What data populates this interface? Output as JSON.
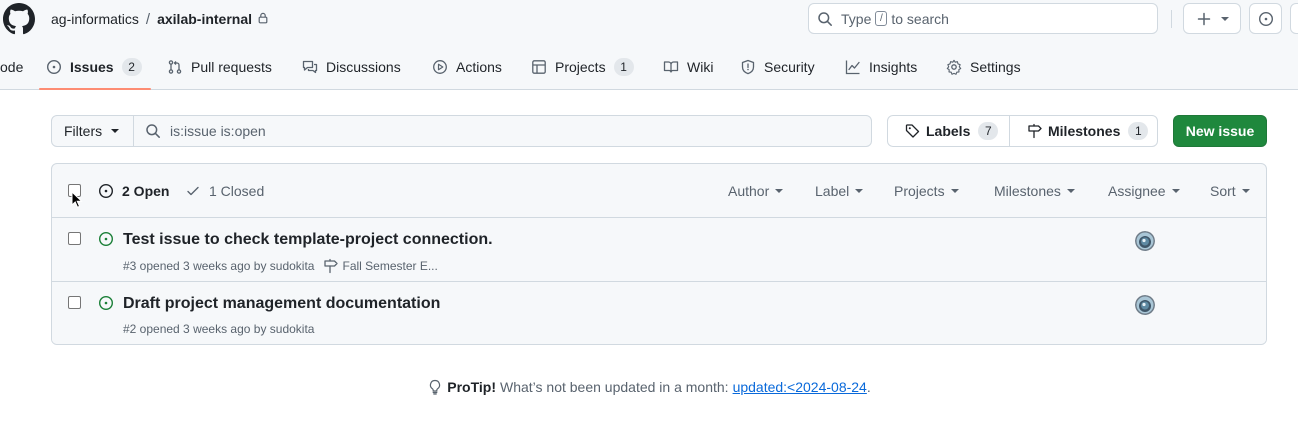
{
  "header": {
    "org": "ag-informatics",
    "separator": "/",
    "repo": "axilab-internal",
    "search_prefix": "Type",
    "search_key": "/",
    "search_suffix": "to search"
  },
  "nav": {
    "code_label": "ode",
    "issues_label": "Issues",
    "issues_count": "2",
    "pulls_label": "Pull requests",
    "discussions_label": "Discussions",
    "actions_label": "Actions",
    "projects_label": "Projects",
    "projects_count": "1",
    "wiki_label": "Wiki",
    "security_label": "Security",
    "insights_label": "Insights",
    "settings_label": "Settings"
  },
  "toolbar": {
    "filters_label": "Filters",
    "filter_query": "is:issue is:open",
    "labels_label": "Labels",
    "labels_count": "7",
    "milestones_label": "Milestones",
    "milestones_count": "1",
    "new_issue_label": "New issue"
  },
  "list_header": {
    "open_label": "2 Open",
    "closed_label": "1 Closed",
    "filters": [
      "Author",
      "Label",
      "Projects",
      "Milestones",
      "Assignee",
      "Sort"
    ]
  },
  "issues": [
    {
      "title": "Test issue to check template-project connection.",
      "meta": "#3 opened 3 weeks ago by sudokita",
      "milestone": "Fall Semester E..."
    },
    {
      "title": "Draft project management documentation",
      "meta": "#2 opened 3 weeks ago by sudokita",
      "milestone": ""
    }
  ],
  "protip": {
    "label": "ProTip!",
    "text": "What’s not been updated in a month:",
    "link": "updated:<2024-08-24",
    "end": "."
  },
  "colors": {
    "accent_green": "#1f883d",
    "open_icon": "#1a7f37",
    "link": "#0969da",
    "underline": "#fd8c73"
  }
}
